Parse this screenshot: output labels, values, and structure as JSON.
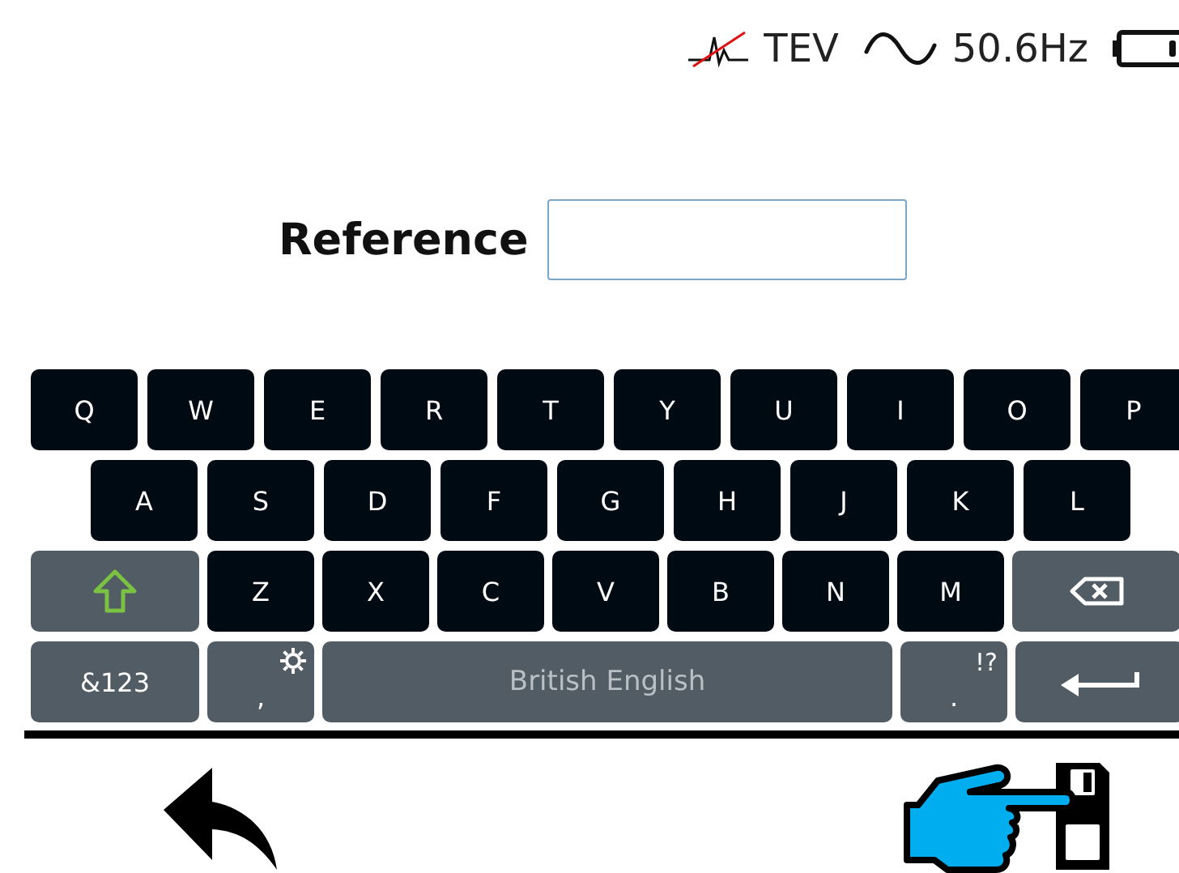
{
  "status_bar": {
    "items": [
      {
        "kind": "tev",
        "label": "TEV"
      },
      {
        "kind": "frequency",
        "label": "50.6Hz"
      },
      {
        "kind": "battery"
      }
    ]
  },
  "form": {
    "label": "Reference"
  },
  "keyboard": {
    "rows": [
      {
        "keys": [
          {
            "kind": "char",
            "label": "Q"
          },
          {
            "kind": "char",
            "label": "W"
          },
          {
            "kind": "char",
            "label": "E"
          },
          {
            "kind": "char",
            "label": "R"
          },
          {
            "kind": "char",
            "label": "T"
          },
          {
            "kind": "char",
            "label": "Y"
          },
          {
            "kind": "char",
            "label": "U"
          },
          {
            "kind": "char",
            "label": "I"
          },
          {
            "kind": "char",
            "label": "O"
          },
          {
            "kind": "char",
            "label": "P"
          }
        ]
      },
      {
        "keys": [
          {
            "kind": "char",
            "label": "A"
          },
          {
            "kind": "char",
            "label": "S"
          },
          {
            "kind": "char",
            "label": "D"
          },
          {
            "kind": "char",
            "label": "F"
          },
          {
            "kind": "char",
            "label": "G"
          },
          {
            "kind": "char",
            "label": "H"
          },
          {
            "kind": "char",
            "label": "J"
          },
          {
            "kind": "char",
            "label": "K"
          },
          {
            "kind": "char",
            "label": "L"
          }
        ]
      },
      {
        "keys": [
          {
            "kind": "shift"
          },
          {
            "kind": "char",
            "label": "Z"
          },
          {
            "kind": "char",
            "label": "X"
          },
          {
            "kind": "char",
            "label": "C"
          },
          {
            "kind": "char",
            "label": "V"
          },
          {
            "kind": "char",
            "label": "B"
          },
          {
            "kind": "char",
            "label": "N"
          },
          {
            "kind": "char",
            "label": "M"
          },
          {
            "kind": "backspace"
          }
        ]
      },
      {
        "keys": [
          {
            "kind": "mode",
            "label": "&123"
          },
          {
            "kind": "comma",
            "label": ","
          },
          {
            "kind": "space",
            "label": "British English"
          },
          {
            "kind": "period",
            "label": ".",
            "hint": "!?"
          },
          {
            "kind": "enter"
          }
        ]
      }
    ]
  },
  "actions": [
    {
      "kind": "back"
    },
    {
      "kind": "save"
    }
  ]
}
